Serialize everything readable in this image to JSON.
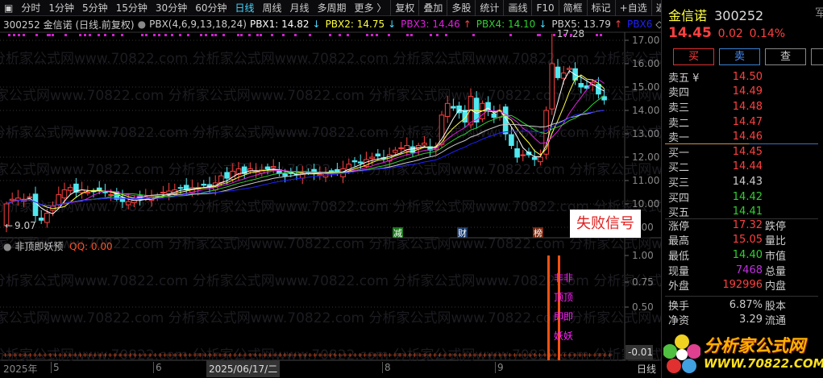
{
  "toolbar": {
    "items": [
      "分时",
      "1分钟",
      "5分钟",
      "15分钟",
      "30分钟",
      "60分钟",
      "日线",
      "周线",
      "月线",
      "多周期",
      "更多 〉",
      "复权",
      "叠加",
      "多股",
      "统计",
      "画线",
      "F10",
      "简框",
      "标记",
      "+自选",
      "返回"
    ],
    "active": "日线"
  },
  "info": {
    "code_title": "300252 金信诺 (日线.前复权)",
    "indicator": "PBX(4,6,9,13,18,24)",
    "pbx": [
      {
        "label": "PBX1: 14.82",
        "arrow": "↓",
        "color": "#ffffff",
        "arrow_color": "#4ad8ff"
      },
      {
        "label": "PBX2: 14.75",
        "arrow": "↓",
        "color": "#ffff40",
        "arrow_color": "#4ad8ff"
      },
      {
        "label": "PBX3: 14.46",
        "arrow": "↑",
        "color": "#e020e0",
        "arrow_color": "#ff4040"
      },
      {
        "label": "PBX4: 14.10",
        "arrow": "↓",
        "color": "#30d030",
        "arrow_color": "#4ad8ff"
      },
      {
        "label": "PBX5: 13.79",
        "arrow": "↑",
        "color": "#cccccc",
        "arrow_color": "#ff4040"
      },
      {
        "label": "PBX6",
        "arrow": "◇",
        "color": "#2020ff",
        "arrow_color": "#cccccc"
      }
    ]
  },
  "watermark": "分析家公式网www.70822.com",
  "chart_data": {
    "type": "candlestick",
    "closes": [
      10.0,
      10.2,
      10.25,
      10.2,
      10.3,
      9.5,
      9.3,
      9.6,
      9.9,
      10.4,
      10.6,
      10.7,
      10.5,
      10.6,
      10.5,
      10.55,
      10.6,
      10.5,
      10.4,
      10.2,
      10.1,
      10.1,
      10.2,
      10.2,
      10.3,
      10.3,
      10.35,
      10.5,
      10.55,
      10.6,
      10.7,
      10.6,
      10.7,
      10.7,
      10.8,
      10.75,
      10.9,
      11.2,
      11.1,
      11.4,
      11.5,
      11.3,
      11.5,
      11.4,
      11.45,
      11.5,
      11.6,
      11.3,
      11.2,
      11.3,
      11.25,
      11.3,
      11.35,
      11.3,
      11.25,
      11.3,
      11.4,
      11.3,
      11.5,
      11.7,
      11.8,
      11.75,
      11.9,
      12.0,
      12.05,
      11.95,
      12.1,
      12.3,
      12.4,
      12.5,
      12.2,
      12.5,
      12.6,
      12.3,
      12.4,
      13.8,
      14.3,
      14.1,
      13.9,
      13.5,
      14.6,
      13.5,
      14.3,
      14.0,
      13.7,
      14.0,
      13.0,
      12.5,
      12.0,
      12.1,
      12.1,
      11.9,
      12.0,
      14.0,
      16.0,
      15.4,
      15.6,
      15.8,
      15.3,
      15.0,
      14.95,
      15.2,
      14.7,
      14.45
    ],
    "first_open": 9.07,
    "ma_periods": [
      4,
      6,
      9,
      13,
      18,
      24
    ],
    "ma_colors": [
      "#ffffff",
      "#ffff40",
      "#e020e0",
      "#30d030",
      "#cccccc",
      "#2020ff"
    ],
    "ylim": [
      9.0,
      17.6
    ],
    "yticks": [
      "17.00",
      "16.00",
      "15.00",
      "14.00",
      "13.00",
      "12.00",
      "11.00",
      "10.00",
      "9.00"
    ],
    "high_label": "17.28",
    "low_label": "9.07"
  },
  "events": [
    {
      "text": "减",
      "bg": "#1a7a1a"
    },
    {
      "text": "财",
      "bg": "#1a3a6a"
    },
    {
      "text": "榜",
      "bg": "#7a2a10"
    }
  ],
  "fail_signal": "失败信号",
  "sub": {
    "title": "非顶即妖预",
    "qq": "QQ: 0.00",
    "yticks": [
      "1.00",
      "0.75",
      "0.50"
    ],
    "cur": "-0.01",
    "chars": [
      "非非",
      "顶顶",
      "即即",
      "妖妖"
    ]
  },
  "dates": {
    "year": "2025年",
    "m5": "5",
    "m6": "6",
    "cursor": "2025/06/17/二",
    "m8": "8",
    "m9": "9",
    "period": "日线"
  },
  "right": {
    "name": "金信诺",
    "code": "300252",
    "cut": "军",
    "price": "14.45",
    "change": "0.02",
    "pct": "0.14%",
    "buy": "买",
    "sell": "卖",
    "query": "查",
    "asks": [
      {
        "l": "卖五 ¥",
        "p": "14.50",
        "c": "#ff4040"
      },
      {
        "l": "卖四",
        "p": "14.49",
        "c": "#ff4040"
      },
      {
        "l": "卖三",
        "p": "14.48",
        "c": "#ff4040"
      },
      {
        "l": "卖二",
        "p": "14.47",
        "c": "#ff4040"
      },
      {
        "l": "卖一",
        "p": "14.46",
        "c": "#ff4040"
      }
    ],
    "bids": [
      {
        "l": "买一",
        "p": "14.45",
        "c": "#ff4040"
      },
      {
        "l": "买二",
        "p": "14.44",
        "c": "#ff4040"
      },
      {
        "l": "买三",
        "p": "14.43",
        "c": "#cccccc"
      },
      {
        "l": "买四",
        "p": "14.42",
        "c": "#30d030"
      },
      {
        "l": "买五",
        "p": "14.41",
        "c": "#30d030"
      }
    ],
    "stats": [
      {
        "l": "涨停",
        "v": "17.32",
        "c": "#ff4040",
        "l2": "跌停"
      },
      {
        "l": "最高",
        "v": "15.05",
        "c": "#ff4040",
        "l2": "量比"
      },
      {
        "l": "最低",
        "v": "14.40",
        "c": "#30d030",
        "l2": "市值"
      },
      {
        "l": "现量",
        "v": "7468",
        "c": "#c030e0",
        "l2": "总量"
      },
      {
        "l": "外盘",
        "v": "192996",
        "c": "#ff4040",
        "l2": "内盘"
      }
    ],
    "stats2": [
      {
        "l": "换手",
        "v": "6.87%",
        "c": "#cccccc",
        "l2": "股本"
      },
      {
        "l": "净资",
        "v": "3.29",
        "c": "#cccccc",
        "l2": "流通"
      }
    ],
    "logo": {
      "title": "分析家公式网",
      "url": "WWW.70822.COM"
    }
  }
}
